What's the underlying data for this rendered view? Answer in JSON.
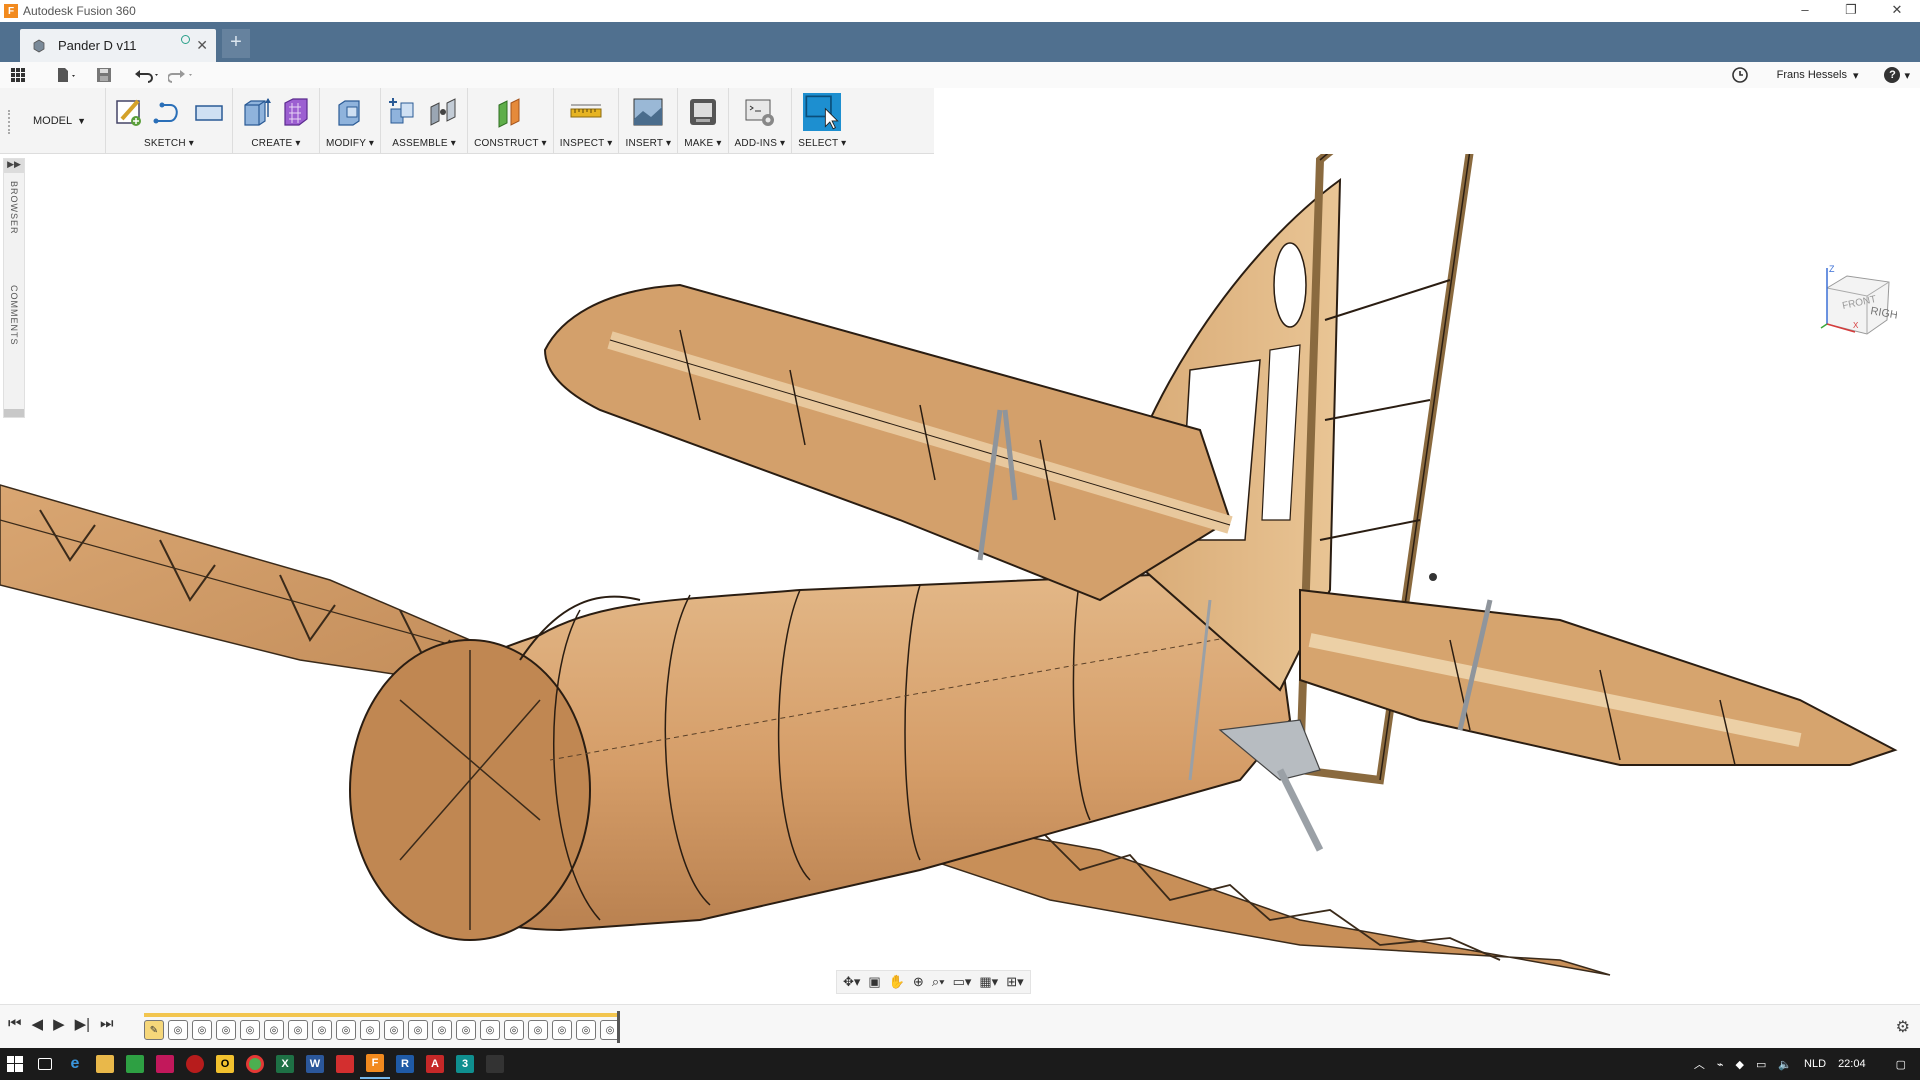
{
  "window": {
    "app_title": "Autodesk Fusion 360",
    "logo_letter": "F",
    "controls": [
      "–",
      "❐",
      "✕"
    ]
  },
  "tabs": {
    "document_tab": "Pander D v11",
    "new_tab": "+"
  },
  "quick_access": {
    "user": "Frans Hessels",
    "user_caret": "▾",
    "help": "?"
  },
  "ribbon": {
    "workspace": "MODEL",
    "groups": {
      "sketch": "SKETCH",
      "create": "CREATE",
      "modify": "MODIFY",
      "assemble": "ASSEMBLE",
      "construct": "CONSTRUCT",
      "inspect": "INSPECT",
      "insert": "INSERT",
      "make": "MAKE",
      "addins": "ADD-INS",
      "select": "SELECT"
    }
  },
  "side_panel": {
    "browser": "BROWSER",
    "comments": "COMMENTS",
    "toggle": "▶▶"
  },
  "viewcube": {
    "face_right": "RIGHT",
    "face_front": "FRONT",
    "axis_z": "Z",
    "axis_x": "X"
  },
  "timeline": {
    "feature_count": 20
  },
  "taskbar": {
    "language": "NLD",
    "time": "22:04"
  },
  "colors": {
    "tab_bar": "#50708f",
    "wood": "#d7a36e",
    "select_accent": "#1d8fd0",
    "timeline_accent": "#f2c54f"
  }
}
